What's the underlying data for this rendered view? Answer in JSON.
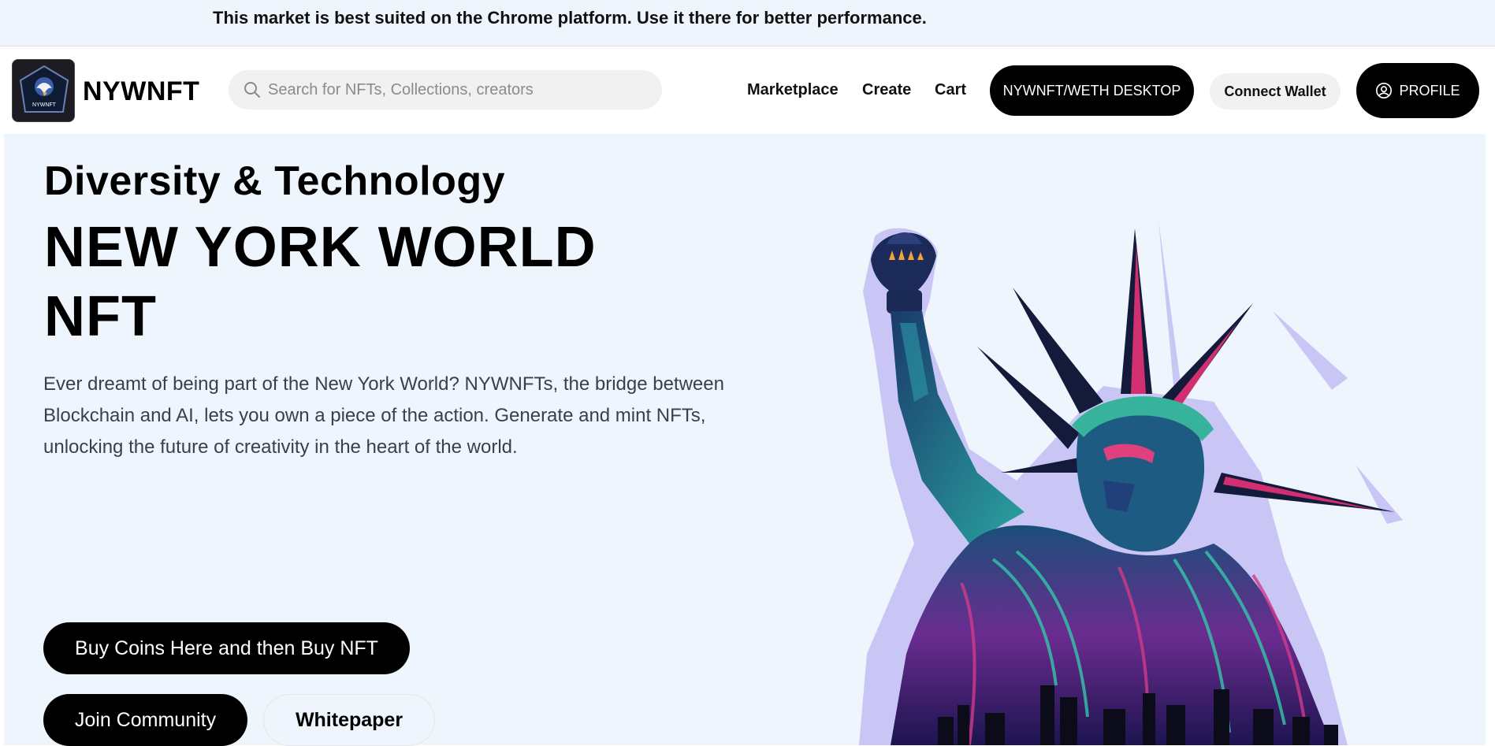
{
  "banner": {
    "text": "This market is best suited on the Chrome platform. Use it there for better performance."
  },
  "nav": {
    "brand": "NYWNFT",
    "logo_text": "NYWNFT",
    "search_placeholder": "Search for NFTs, Collections, creators",
    "links": [
      "Marketplace",
      "Create",
      "Cart"
    ],
    "desktop_button": "NYWNFT/WETH DESKTOP",
    "connect_wallet": "Connect Wallet",
    "profile": "PROFILE"
  },
  "hero": {
    "subtitle": "Diversity & Technology",
    "title": "NEW YORK WORLD NFT",
    "description": "Ever dreamt of being part of the New York World? NYWNFTs, the bridge between Blockchain and AI, lets you own a piece of the action. Generate and mint NFTs, unlocking the future of creativity in the heart of the world.",
    "buy_button": "Buy Coins Here and then Buy NFT",
    "community_button": "Join Community",
    "whitepaper_button": "Whitepaper"
  },
  "colors": {
    "banner_bg": "#eef5fd",
    "hero_bg": "#eef5fd",
    "primary_button": "#000000",
    "light_button": "#f1f1f2"
  },
  "icons": {
    "search": "search-icon",
    "profile": "user-circle-icon",
    "logo": "eagle-logo-icon",
    "hero_image": "statue-of-liberty-illustration"
  }
}
